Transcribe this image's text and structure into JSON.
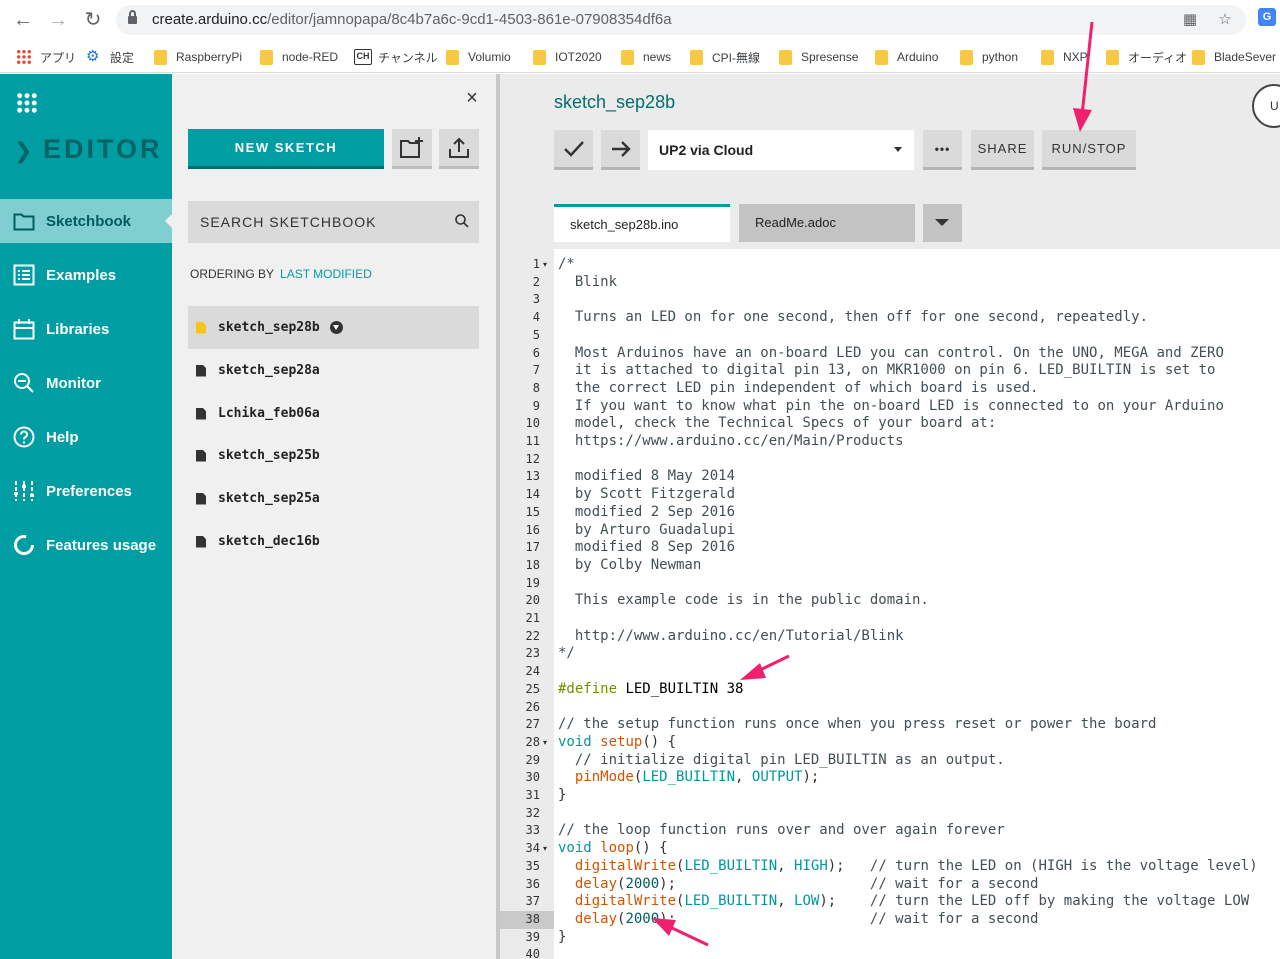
{
  "browser": {
    "url_host": "create.arduino.cc",
    "url_path": "/editor/jamnopapa/8c4b7a6c-9cd1-4503-861e-07908354df6a",
    "profile_badge": "G",
    "bookmarks": [
      "アプリ",
      "設定",
      "RaspberryPi",
      "node-RED",
      "チャンネル",
      "Volumio",
      "IOT2020",
      "news",
      "CPI-無線",
      "Spresense",
      "Arduino",
      "python",
      "NXP",
      "オーディオ",
      "BladeSever"
    ]
  },
  "leftnav": {
    "logo": "EDITOR",
    "items": [
      "Sketchbook",
      "Examples",
      "Libraries",
      "Monitor",
      "Help",
      "Preferences",
      "Features usage"
    ]
  },
  "sketchbook": {
    "new_sketch": "NEW SKETCH",
    "search_placeholder": "SEARCH SKETCHBOOK",
    "ordering_label": "ORDERING BY",
    "ordering_value": "LAST MODIFIED",
    "sketches": [
      "sketch_sep28b",
      "sketch_sep28a",
      "Lchika_feb06a",
      "sketch_sep25b",
      "sketch_sep25a",
      "sketch_dec16b"
    ]
  },
  "editor": {
    "title": "sketch_sep28b",
    "top_right_partial": "U",
    "board": "UP2 via Cloud",
    "more_label": "•••",
    "share_label": "SHARE",
    "runstop_label": "RUN/STOP",
    "tabs": [
      "sketch_sep28b.ino",
      "ReadMe.adoc"
    ],
    "highlighted_line": 38,
    "code_lines": [
      "/*",
      "  Blink",
      "",
      "  Turns an LED on for one second, then off for one second, repeatedly.",
      "",
      "  Most Arduinos have an on-board LED you can control. On the UNO, MEGA and ZERO",
      "  it is attached to digital pin 13, on MKR1000 on pin 6. LED_BUILTIN is set to",
      "  the correct LED pin independent of which board is used.",
      "  If you want to know what pin the on-board LED is connected to on your Arduino",
      "  model, check the Technical Specs of your board at:",
      "  https://www.arduino.cc/en/Main/Products",
      "",
      "  modified 8 May 2014",
      "  by Scott Fitzgerald",
      "  modified 2 Sep 2016",
      "  by Arturo Guadalupi",
      "  modified 8 Sep 2016",
      "  by Colby Newman",
      "",
      "  This example code is in the public domain.",
      "",
      "  http://www.arduino.cc/en/Tutorial/Blink",
      "*/",
      "",
      "#define LED_BUILTIN 38",
      "",
      "// the setup function runs once when you press reset or power the board",
      "void setup() {",
      "  // initialize digital pin LED_BUILTIN as an output.",
      "  pinMode(LED_BUILTIN, OUTPUT);",
      "}",
      "",
      "// the loop function runs over and over again forever",
      "void loop() {",
      "  digitalWrite(LED_BUILTIN, HIGH);   // turn the LED on (HIGH is the voltage level)",
      "  delay(2000);                       // wait for a second",
      "  digitalWrite(LED_BUILTIN, LOW);    // turn the LED off by making the voltage LOW",
      "  delay(2000);                       // wait for a second",
      "}",
      ""
    ]
  },
  "colors": {
    "teal": "#009ea3",
    "annotation_arrow": "#f0206e"
  }
}
